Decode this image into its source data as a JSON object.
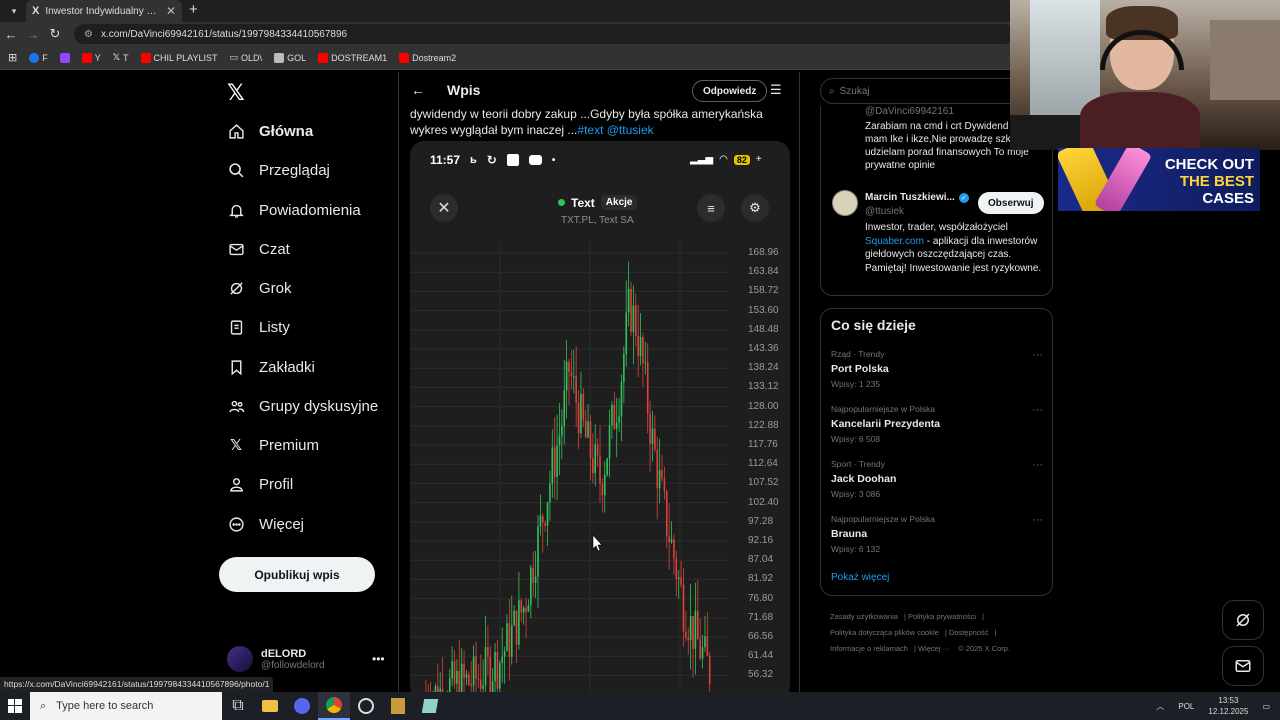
{
  "browser": {
    "tab_title": "Inwestor Indywidualny w serwisie X",
    "tab_favicon": "X",
    "tab_close": "✕",
    "new_tab": "+",
    "url": "x.com/DaVinci69942161/status/1997984334410567896",
    "bookmarks": [
      {
        "label": "F",
        "icon": "facebook-icon",
        "color": "#1877f2"
      },
      {
        "label": "",
        "icon": "twitch-icon",
        "color": "#9146ff"
      },
      {
        "label": "Y",
        "icon": "youtube-icon",
        "color": "#ff0000"
      },
      {
        "label": "T",
        "icon": "x-icon",
        "color": "#ffffff"
      },
      {
        "label": "CHIL PLAYLIST",
        "icon": "youtube-icon",
        "color": "#ff0000"
      },
      {
        "label": "OLD\\",
        "icon": "folder-icon",
        "color": "#cccccc"
      },
      {
        "label": "GOL",
        "icon": "gol-icon",
        "color": "#bbbbbb"
      },
      {
        "label": "DOSTREAM1",
        "icon": "youtube-icon",
        "color": "#ff0000"
      },
      {
        "label": "Dostream2",
        "icon": "youtube-icon",
        "color": "#ff0000"
      }
    ],
    "hover_url": "https://x.com/DaVinci69942161/status/1997984334410567896/photo/1"
  },
  "nav": {
    "items": [
      {
        "label": "Główna",
        "icon": "home-icon"
      },
      {
        "label": "Przeglądaj",
        "icon": "search-icon"
      },
      {
        "label": "Powiadomienia",
        "icon": "bell-icon"
      },
      {
        "label": "Czat",
        "icon": "mail-icon"
      },
      {
        "label": "Grok",
        "icon": "grok-icon"
      },
      {
        "label": "Listy",
        "icon": "list-icon"
      },
      {
        "label": "Zakładki",
        "icon": "bookmark-icon"
      },
      {
        "label": "Grupy dyskusyjne",
        "icon": "people-icon"
      },
      {
        "label": "Premium",
        "icon": "x-icon"
      },
      {
        "label": "Profil",
        "icon": "person-icon"
      },
      {
        "label": "Więcej",
        "icon": "more-circle-icon"
      }
    ],
    "post_button": "Opublikuj wpis",
    "account": {
      "name": "dELORD",
      "handle": "@followdelord"
    }
  },
  "post": {
    "header_title": "Wpis",
    "reply_button": "Odpowiedz",
    "text_line1": "dywidendy w teorii dobry zakup ...Gdyby była spółka amerykańska",
    "text_line2_prefix": "wykres wyglądał bym inaczej ...",
    "hashtag": "#text",
    "mention": "@ttusiek"
  },
  "phone": {
    "time": "11:57",
    "battery": "82",
    "ticker": "Text",
    "tag": "Akcje",
    "subtitle": "TXT.PL, Text SA"
  },
  "chart_data": {
    "type": "candlestick",
    "title": "Text",
    "y_tick_labels": [
      "168.96",
      "163.84",
      "158.72",
      "153.60",
      "148.48",
      "143.36",
      "138.24",
      "133.12",
      "128.00",
      "122.88",
      "117.76",
      "112.64",
      "107.52",
      "102.40",
      "97.28",
      "92.16",
      "87.04",
      "81.92",
      "76.80",
      "71.68",
      "66.56",
      "61.44",
      "56.32"
    ],
    "ylim": [
      56.32,
      168.96
    ],
    "grid": true,
    "colors": {
      "up": "#31c45a",
      "down": "#e0413d"
    },
    "series_note_path": [
      [
        0.05,
        50
      ],
      [
        0.12,
        53
      ],
      [
        0.2,
        55
      ],
      [
        0.28,
        60
      ],
      [
        0.36,
        75
      ],
      [
        0.42,
        100
      ],
      [
        0.48,
        125
      ],
      [
        0.5,
        138
      ],
      [
        0.55,
        120
      ],
      [
        0.6,
        108
      ],
      [
        0.64,
        125
      ],
      [
        0.66,
        133
      ],
      [
        0.69,
        155
      ],
      [
        0.71,
        150
      ],
      [
        0.73,
        140
      ],
      [
        0.76,
        120
      ],
      [
        0.8,
        100
      ],
      [
        0.83,
        88
      ],
      [
        0.86,
        75
      ],
      [
        0.89,
        68
      ],
      [
        0.92,
        62
      ],
      [
        0.95,
        56
      ]
    ]
  },
  "right": {
    "search_placeholder": "Szukaj",
    "card": {
      "prev_handle": "@DaVinci69942161",
      "prev_bio": "Zarabiam na cmd i crt Dywidend spółki mam Ike i ikze,Nie prowadzę szkoleń Nie udzielam porad finansowych To moje prywatne opinie",
      "name": "Marcin Tuszkiewi...",
      "handle": "@ttusiek",
      "follow": "Obserwuj",
      "bio_prefix": "Inwestor, trader, współzałożyciel",
      "bio_link": "Squaber.com",
      "bio_rest": " - aplikacji dla inwestorów giełdowych oszczędzającej czas. Pamiętaj! Inwestowanie jest ryzykowne."
    },
    "trends_title": "Co się dzieje",
    "trends": [
      {
        "category": "Rząd · Trendy",
        "name": "Port Polska",
        "count": "Wpisy: 1 235"
      },
      {
        "category": "Najpopularniejsze w Polska",
        "name": "Kancelarii Prezydenta",
        "count": "Wpisy: 6 508"
      },
      {
        "category": "Sport · Trendy",
        "name": "Jack Doohan",
        "count": "Wpisy: 3 086"
      },
      {
        "category": "Najpopularniejsze w Polska",
        "name": "Brauna",
        "count": "Wpisy: 6 132"
      }
    ],
    "show_more": "Pokaż więcej",
    "footer": [
      "Zasady użytkowania",
      "Polityka prywatności",
      "Polityka dotycząca plików cookie",
      "Dostępność",
      "Informacje o reklamach",
      "Więcej ···",
      "© 2025 X Corp."
    ]
  },
  "ad": {
    "line1": "CHECK OUT",
    "line2": "THE BEST",
    "line3": "CASES"
  },
  "taskbar": {
    "search_placeholder": "Type here to search",
    "lang": "POL",
    "time": "13:53",
    "date": "12.12.2025"
  }
}
